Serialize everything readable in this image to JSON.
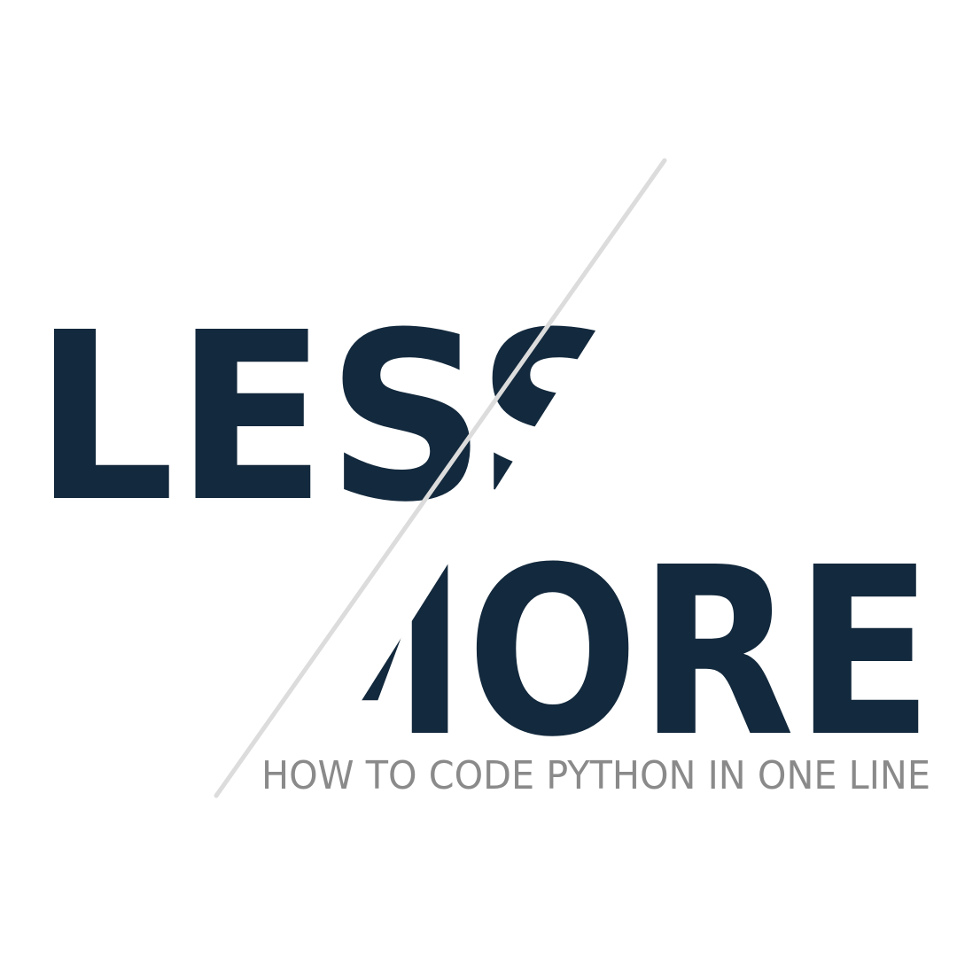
{
  "word_top": "LESS",
  "word_bottom": "MORE",
  "subtitle": "HOW TO CODE PYTHON IN ONE LINE",
  "colors": {
    "background": "#ffffff",
    "word": "#13293d",
    "slash": "#dcdcdc",
    "subtitle": "#8a8a8a"
  }
}
